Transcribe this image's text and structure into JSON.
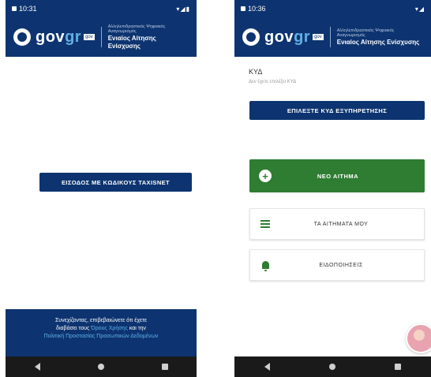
{
  "colors": {
    "brand_blue": "#0d3470",
    "accent_light_blue": "#5fb1e6",
    "green": "#2e7d32",
    "nav_black": "#1a1a1a"
  },
  "header": {
    "logo_text_main": "gov",
    "logo_text_accent": "gr",
    "logo_badge": "gov",
    "ministry": "Aλληλεπιδραστικός Ψηφιακός Αναγνωρισμός",
    "service_title": "Ενιαίος Αίτησης Ενίσχυσης"
  },
  "left_screen": {
    "status_time": "10:31",
    "status_right": "▾◢▮",
    "login_button_label": "ΕΙΣΟΔΟΣ ΜΕ ΚΩΔΙΚΟΥΣ TAXISNET",
    "consent_text_1": "Συνεχίζοντας, επιβεβαιώνετε ότι έχετε",
    "consent_text_2": "διαβάσει τους",
    "consent_link_1": "Όρους Χρήσης",
    "consent_text_3": "και την",
    "consent_link_2": "Πολιτική Προστασίας Προσωπικών Δεδομένων"
  },
  "right_screen": {
    "status_time": "10:36",
    "status_right": "▾◢",
    "kyd_label": "ΚΥΔ",
    "kyd_subtext": "Δεν έχετε επιλέξει ΚΥΔ",
    "select_kyd_button_label": "ΕΠΙΛΕΞΤΕ ΚΥΔ ΕΞΥΠΗΡΕΤΗΣΗΣ",
    "new_request_label": "ΝΕΟ ΑΙΤΗΜΑ",
    "my_requests_label": "ΤΑ ΑΙΤΗΜΑΤΑ ΜΟΥ",
    "notifications_label": "ΕΙΔΟΠΟΙΗΣΕΙΣ"
  },
  "navbar": {
    "back_icon": "back-triangle-icon",
    "home_icon": "home-circle-icon",
    "recents_icon": "recents-square-icon"
  }
}
